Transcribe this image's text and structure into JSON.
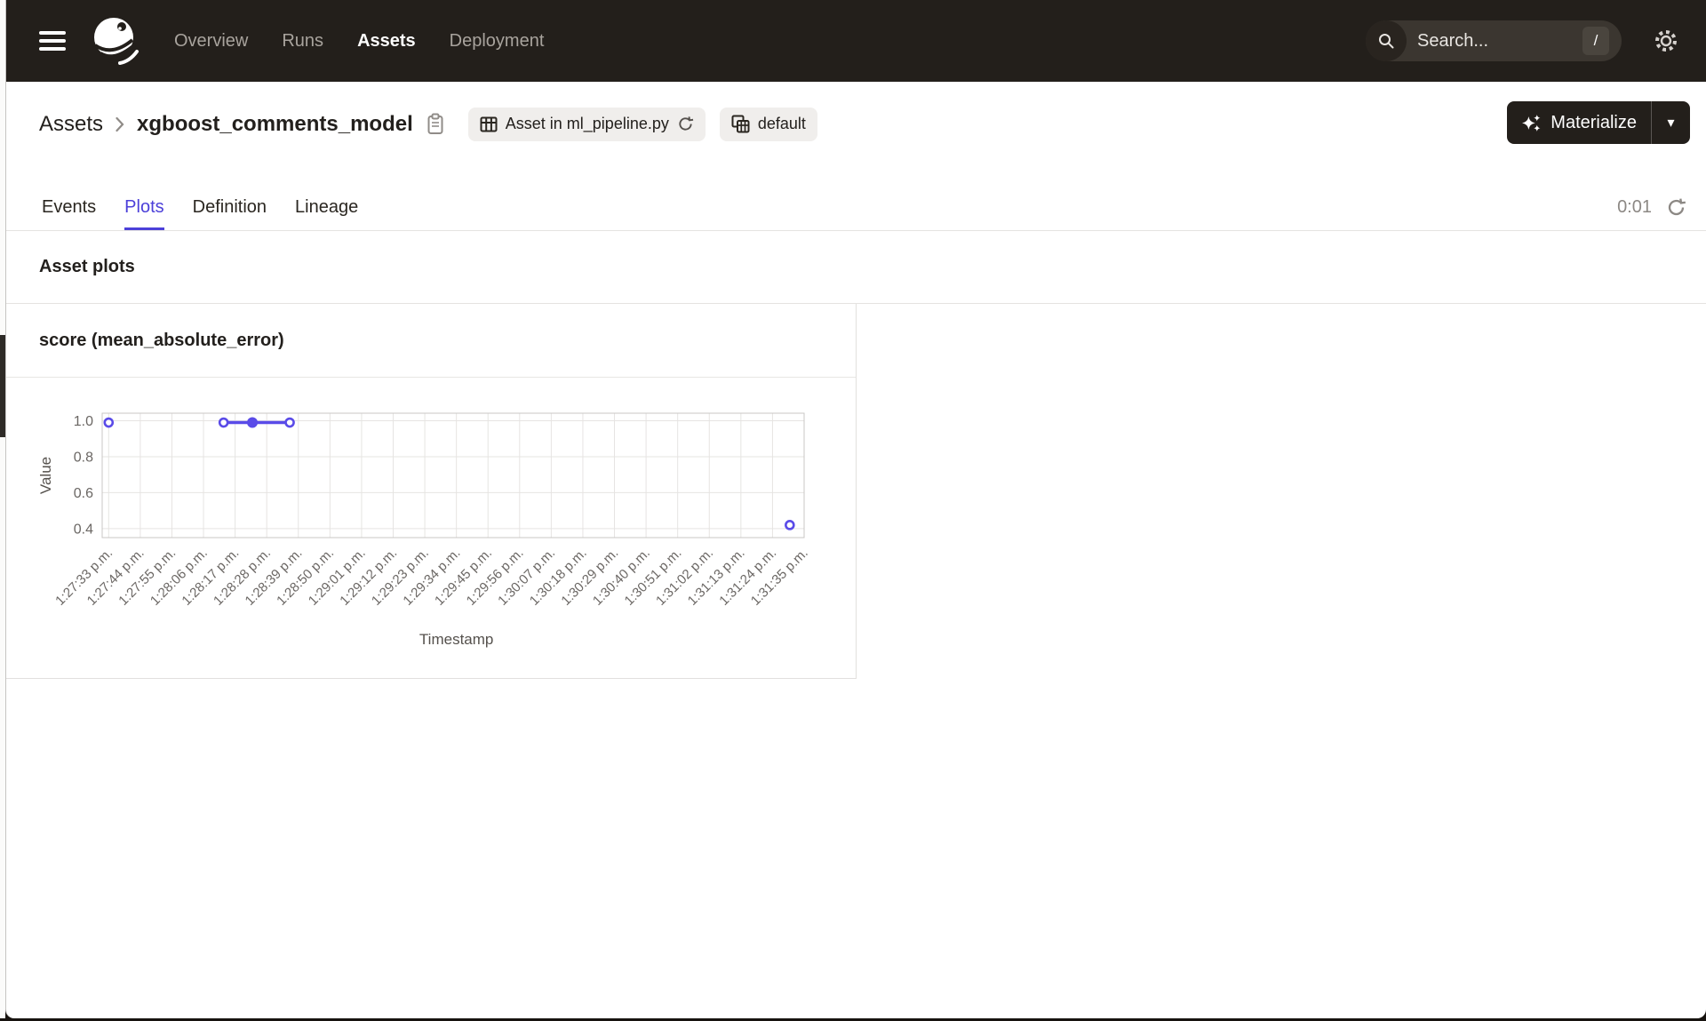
{
  "colors": {
    "nav_bg": "#231f1b",
    "accent": "#4c40d9",
    "line": "#5a4be8",
    "grid": "#e6e4e2",
    "axis_border": "#c9c7c5",
    "tick_text": "#6b6764"
  },
  "nav": {
    "items": [
      {
        "label": "Overview",
        "active": false
      },
      {
        "label": "Runs",
        "active": false
      },
      {
        "label": "Assets",
        "active": true
      },
      {
        "label": "Deployment",
        "active": false
      }
    ],
    "search": {
      "placeholder": "Search...",
      "shortcut": "/"
    }
  },
  "header": {
    "breadcrumb_root": "Assets",
    "asset_name": "xgboost_comments_model",
    "code_location_badge": "Asset in ml_pipeline.py",
    "group_badge": "default",
    "materialize_label": "Materialize"
  },
  "tabs": {
    "items": [
      {
        "label": "Events",
        "active": false
      },
      {
        "label": "Plots",
        "active": true
      },
      {
        "label": "Definition",
        "active": false
      },
      {
        "label": "Lineage",
        "active": false
      }
    ],
    "refresh_timer": "0:01"
  },
  "section": {
    "title": "Asset plots"
  },
  "chart_data": {
    "type": "line",
    "title": "score (mean_absolute_error)",
    "xlabel": "Timestamp",
    "ylabel": "Value",
    "ylim": [
      0.35,
      1.042
    ],
    "yticks": [
      0.4,
      0.6,
      0.8,
      1.0
    ],
    "xticks": [
      "1:27:33 p.m.",
      "1:27:44 p.m.",
      "1:27:55 p.m.",
      "1:28:06 p.m.",
      "1:28:17 p.m.",
      "1:28:28 p.m.",
      "1:28:39 p.m.",
      "1:28:50 p.m.",
      "1:29:01 p.m.",
      "1:29:12 p.m.",
      "1:29:23 p.m.",
      "1:29:34 p.m.",
      "1:29:45 p.m.",
      "1:29:56 p.m.",
      "1:30:07 p.m.",
      "1:30:18 p.m.",
      "1:30:29 p.m.",
      "1:30:40 p.m.",
      "1:30:51 p.m.",
      "1:31:02 p.m.",
      "1:31:13 p.m.",
      "1:31:24 p.m.",
      "1:31:35 p.m."
    ],
    "grid": true,
    "series": [
      {
        "points": [
          {
            "time": "1:27:33 p.m.",
            "value": 0.99,
            "marker": "open"
          }
        ]
      },
      {
        "points": [
          {
            "time": "1:28:13 p.m.",
            "value": 0.99,
            "marker": "open"
          },
          {
            "time": "1:28:23 p.m.",
            "value": 0.99,
            "marker": "filled"
          },
          {
            "time": "1:28:36 p.m.",
            "value": 0.99,
            "marker": "open"
          }
        ]
      },
      {
        "points": [
          {
            "time": "1:31:30 p.m.",
            "value": 0.42,
            "marker": "open"
          }
        ]
      }
    ]
  }
}
